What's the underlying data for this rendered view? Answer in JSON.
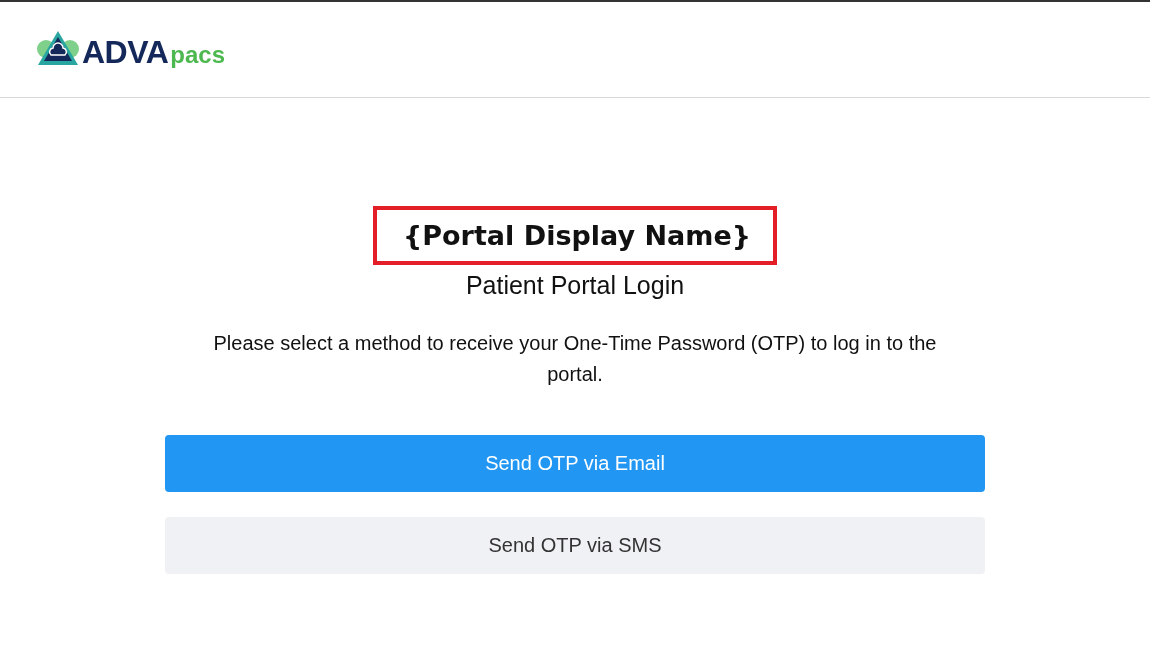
{
  "header": {
    "logo": {
      "brand": "ADVA",
      "suffix": "pacs"
    }
  },
  "login": {
    "portal_name": "{Portal Display Name}",
    "title": "Patient Portal Login",
    "instructions": "Please select a method to receive your One-Time Password (OTP) to log in to the portal.",
    "buttons": [
      {
        "label": "Send OTP via Email",
        "kind": "primary"
      },
      {
        "label": "Send OTP via SMS",
        "kind": "secondary"
      }
    ]
  }
}
